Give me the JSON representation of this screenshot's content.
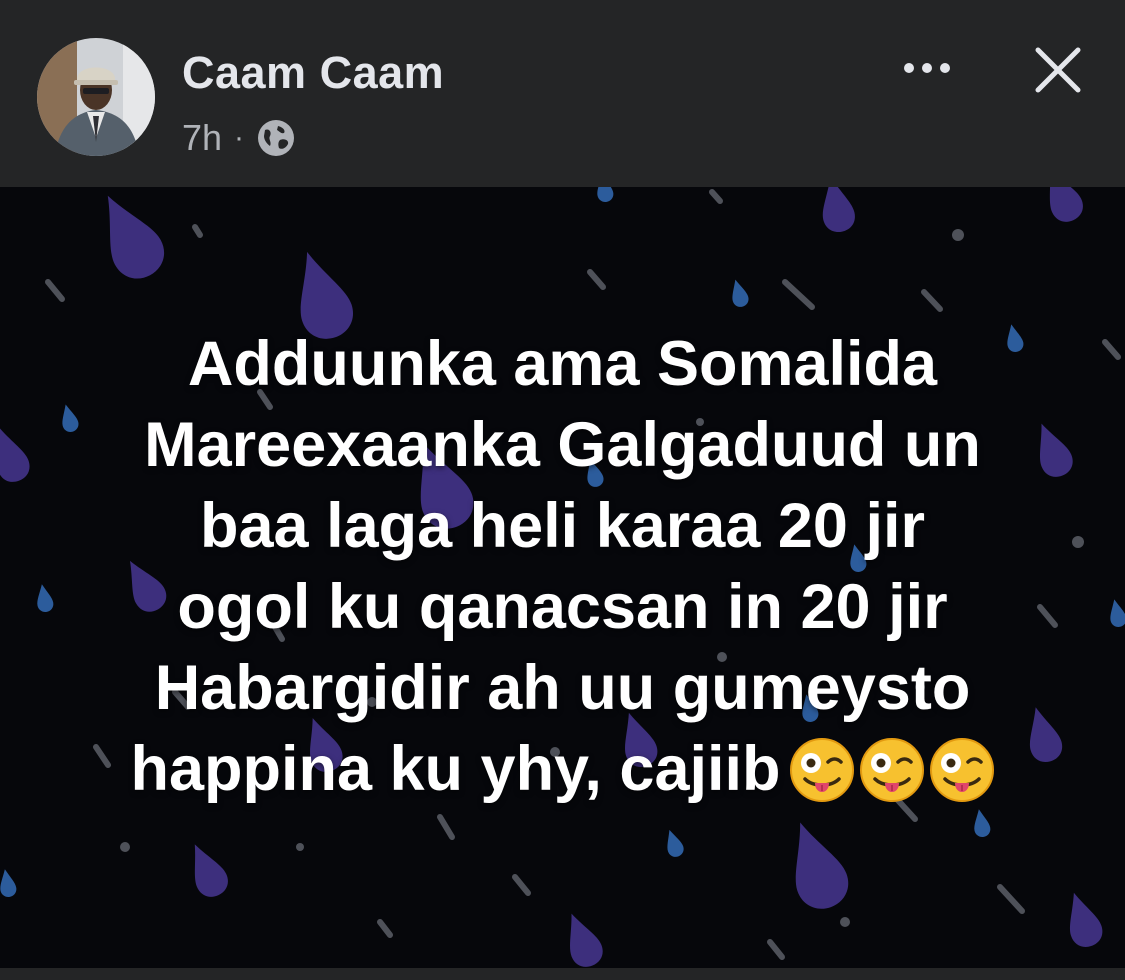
{
  "post": {
    "author": "Caam Caam",
    "time": "7h",
    "separator": "·",
    "privacy_icon": "globe-icon",
    "more_icon": "more-options-icon",
    "close_icon": "close-icon",
    "lines": [
      "Adduunka ama Somalida",
      "Mareexaanka Galgaduud un",
      "baa laga heli karaa 20 jir",
      "ogol ku qanacsan in 20 jir",
      "Habargidir ah uu gumeysto",
      "happina ku yhy, cajiib"
    ],
    "emojis": [
      "😜",
      "😜",
      "😜"
    ],
    "emoji_icon": "winking-face-with-tongue-icon",
    "background_theme": "rain-drops"
  },
  "colors": {
    "header_bg": "#242526",
    "post_bg": "#06070b",
    "drop_purple": "#3d2f7d",
    "drop_blue": "#2c5c9c",
    "drop_gray": "#5a5d66",
    "text": "#ffffff",
    "name_text": "#e4e6eb",
    "meta_text": "#b0b3b8"
  }
}
